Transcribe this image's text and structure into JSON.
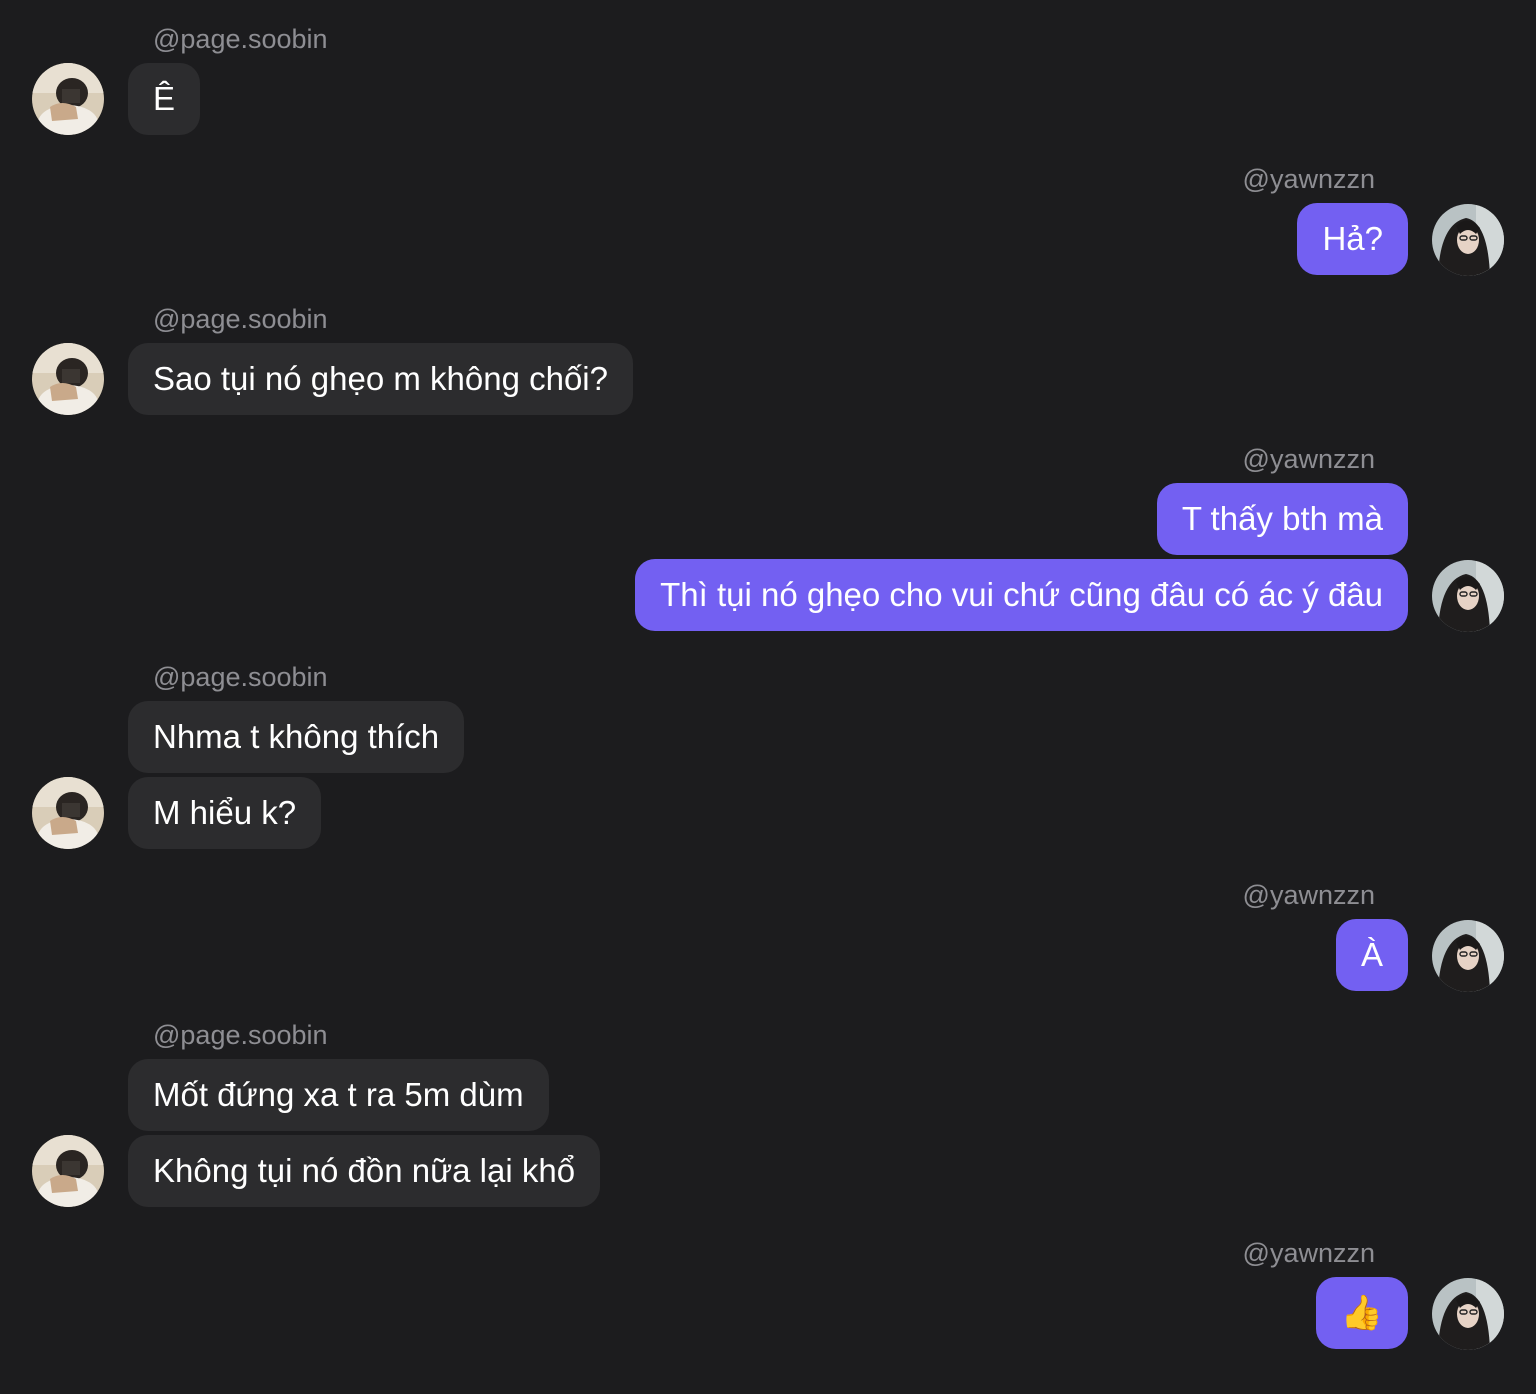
{
  "conversation": {
    "groups": [
      {
        "side": "in",
        "username": "@page.soobin",
        "messages": [
          "Ê"
        ],
        "avatar_icon": "avatar-page-soobin"
      },
      {
        "side": "out",
        "username": "@yawnzzn",
        "messages": [
          "Hả?"
        ],
        "avatar_icon": "avatar-yawnzzn"
      },
      {
        "side": "in",
        "username": "@page.soobin",
        "messages": [
          "Sao tụi nó ghẹo m không chối?"
        ],
        "avatar_icon": "avatar-page-soobin"
      },
      {
        "side": "out",
        "username": "@yawnzzn",
        "messages": [
          "T thấy bth mà",
          "Thì tụi nó ghẹo cho vui chứ cũng đâu có ác ý đâu"
        ],
        "avatar_icon": "avatar-yawnzzn"
      },
      {
        "side": "in",
        "username": "@page.soobin",
        "messages": [
          "Nhma t không thích",
          "M hiểu k?"
        ],
        "avatar_icon": "avatar-page-soobin"
      },
      {
        "side": "out",
        "username": "@yawnzzn",
        "messages": [
          "À"
        ],
        "avatar_icon": "avatar-yawnzzn"
      },
      {
        "side": "in",
        "username": "@page.soobin",
        "messages": [
          "Mốt đứng xa t ra 5m dùm",
          "Không tụi nó đồn nữa lại khổ"
        ],
        "avatar_icon": "avatar-page-soobin"
      },
      {
        "side": "out",
        "username": "@yawnzzn",
        "messages": [
          "👍"
        ],
        "avatar_icon": "avatar-yawnzzn"
      }
    ]
  },
  "colors": {
    "background": "#1c1c1e",
    "incoming_bubble": "#2c2c2e",
    "outgoing_bubble": "#7360f2",
    "username_text": "#8e8e93",
    "message_text": "#ffffff"
  }
}
